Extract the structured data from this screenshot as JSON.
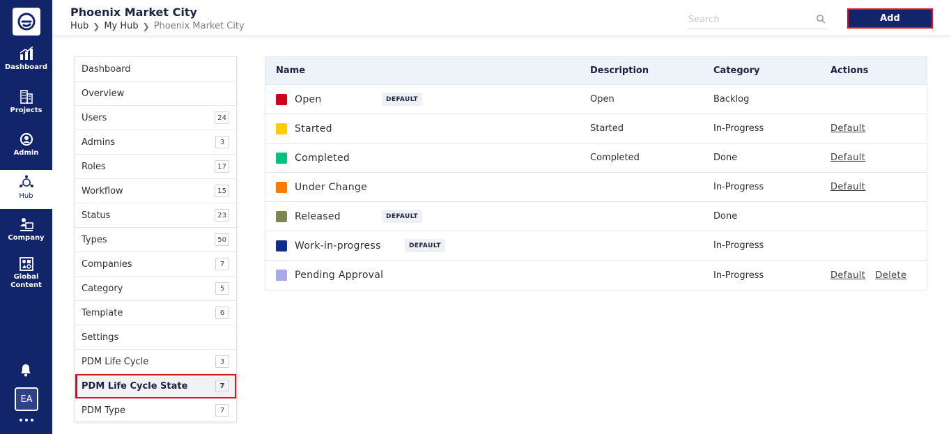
{
  "rail": {
    "items": [
      {
        "label": "Dashboard",
        "icon": "chart-icon"
      },
      {
        "label": "Projects",
        "icon": "buildings-icon"
      },
      {
        "label": "Admin",
        "icon": "admin-gear-icon"
      },
      {
        "label": "Hub",
        "icon": "hub-icon"
      },
      {
        "label": "Company",
        "icon": "company-icon"
      },
      {
        "label": "Global",
        "label2": "Content",
        "icon": "global-content-icon"
      }
    ],
    "avatar": "EA"
  },
  "header": {
    "title": "Phoenix Market City",
    "breadcrumb": [
      "Hub",
      "My Hub",
      "Phoenix Market City"
    ],
    "search_placeholder": "Search",
    "add_label": "Add"
  },
  "menu": [
    {
      "label": "Dashboard",
      "count": ""
    },
    {
      "label": "Overview",
      "count": ""
    },
    {
      "label": "Users",
      "count": "24"
    },
    {
      "label": "Admins",
      "count": "3"
    },
    {
      "label": "Roles",
      "count": "17"
    },
    {
      "label": "Workflow",
      "count": "15"
    },
    {
      "label": "Status",
      "count": "23"
    },
    {
      "label": "Types",
      "count": "50"
    },
    {
      "label": "Companies",
      "count": "7"
    },
    {
      "label": "Category",
      "count": "5"
    },
    {
      "label": "Template",
      "count": "6"
    },
    {
      "label": "Settings",
      "count": ""
    },
    {
      "label": "PDM Life Cycle",
      "count": "3"
    },
    {
      "label": "PDM Life Cycle State",
      "count": "7"
    },
    {
      "label": "PDM Type",
      "count": "7"
    }
  ],
  "table": {
    "headers": {
      "name": "Name",
      "description": "Description",
      "category": "Category",
      "actions": "Actions"
    },
    "rows": [
      {
        "name": "Open",
        "color": "#d0021b",
        "badge": "DEFAULT",
        "description": "Open",
        "category": "Backlog",
        "actions": []
      },
      {
        "name": "Started",
        "color": "#ffcc00",
        "badge": "",
        "description": "Started",
        "category": "In-Progress",
        "actions": [
          "Default"
        ]
      },
      {
        "name": "Completed",
        "color": "#00c27a",
        "badge": "",
        "description": "Completed",
        "category": "Done",
        "actions": [
          "Default"
        ]
      },
      {
        "name": "Under Change",
        "color": "#ff7a00",
        "badge": "",
        "description": "",
        "category": "In-Progress",
        "actions": [
          "Default"
        ]
      },
      {
        "name": "Released",
        "color": "#7d8551",
        "badge": "DEFAULT",
        "description": "",
        "category": "Done",
        "actions": []
      },
      {
        "name": "Work-in-progress",
        "color": "#0f2d8a",
        "badge": "DEFAULT",
        "description": "",
        "category": "In-Progress",
        "actions": []
      },
      {
        "name": "Pending Approval",
        "color": "#a9a9e6",
        "badge": "",
        "description": "",
        "category": "In-Progress",
        "actions": [
          "Default",
          "Delete"
        ]
      }
    ]
  },
  "colors": {
    "rail": "#12256b",
    "accent": "#12256b",
    "highlight": "#e0161f"
  }
}
